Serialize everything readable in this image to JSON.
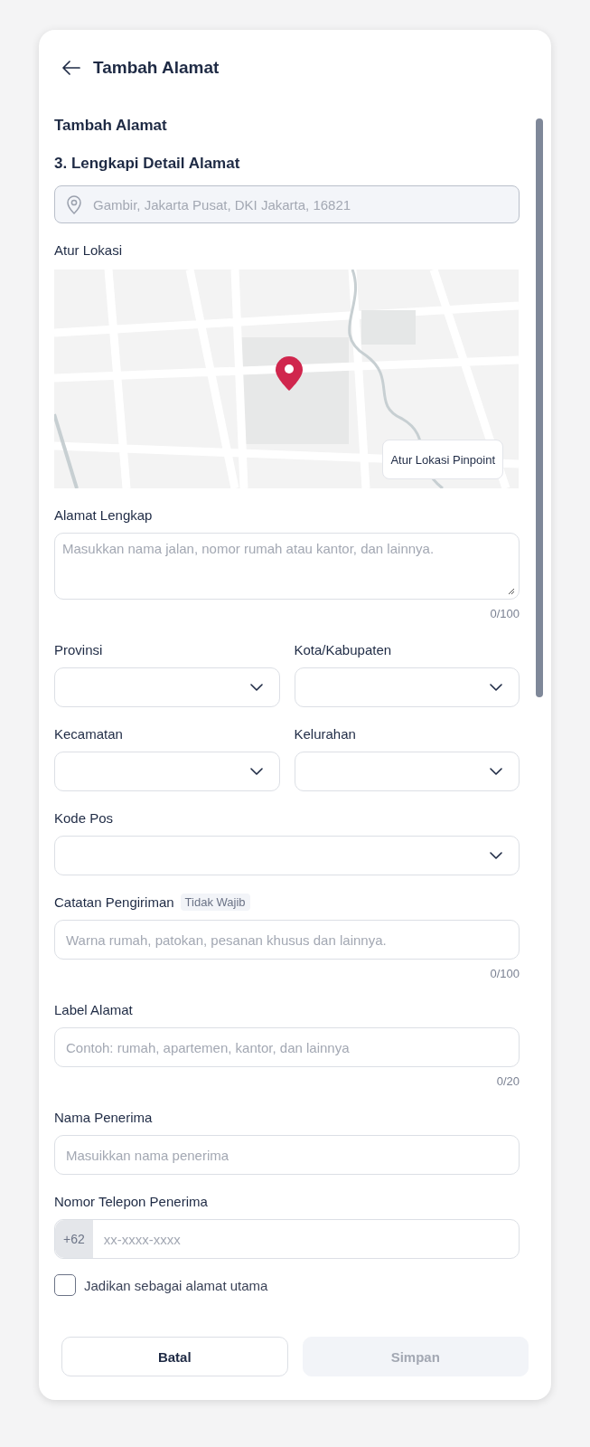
{
  "header": {
    "title": "Tambah Alamat"
  },
  "form": {
    "title": "Tambah Alamat",
    "step": "3. Lengkapi Detail Alamat",
    "location_field": {
      "value": "Gambir, Jakarta Pusat, DKI Jakarta, 16821",
      "disabled": true
    },
    "map": {
      "label": "Atur Lokasi",
      "kind": "picture",
      "pinpoint_button": "Atur Lokasi Pinpoint"
    },
    "rows": [
      [
        {
          "kind": "textarea",
          "label": "Alamat Lengkap",
          "placeholder": "Masukkan nama jalan, nomor rumah atau kantor, dan lainnya.",
          "counter": "0/100"
        }
      ],
      [
        {
          "kind": "select",
          "label": "Provinsi"
        },
        {
          "kind": "select",
          "label": "Kota/Kabupaten"
        }
      ],
      [
        {
          "kind": "select",
          "label": "Kecamatan"
        },
        {
          "kind": "select",
          "label": "Kelurahan"
        }
      ],
      [
        {
          "kind": "select",
          "label": "Kode Pos"
        }
      ],
      [
        {
          "kind": "text",
          "label": "Catatan Pengiriman",
          "badge": "Tidak Wajib",
          "placeholder": "Warna rumah, patokan, pesanan khusus dan lainnya.",
          "counter": "0/100"
        }
      ],
      [
        {
          "kind": "text",
          "label": "Label Alamat",
          "placeholder": "Contoh: rumah, apartemen, kantor, dan lainnya",
          "counter": "0/20"
        }
      ],
      [
        {
          "kind": "text",
          "label": "Nama Penerima",
          "placeholder": "Masuikkan nama penerima"
        }
      ],
      [
        {
          "kind": "phone",
          "label": "Nomor Telepon Penerima",
          "prefix": "+62",
          "placeholder": "xx-xxxx-xxxx"
        }
      ]
    ],
    "checkbox": {
      "label": "Jadikan sebagai alamat utama",
      "checked": false
    }
  },
  "buttons": [
    {
      "label": "Batal",
      "disabled": false
    },
    {
      "label": "Simpan",
      "disabled": true
    }
  ]
}
